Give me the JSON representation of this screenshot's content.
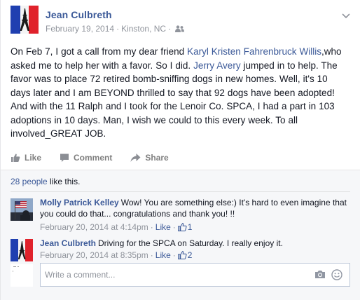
{
  "post": {
    "author": "Jean Culbreth",
    "date": "February 19, 2014",
    "location": "Kinston, NC",
    "audience_icon": "friends-icon",
    "text": {
      "part1": "On Feb 7, I got a call from my dear friend ",
      "link1": "Karyl Kristen Fahrenbruck Willis",
      "part2": ",who asked me to help her with a favor. So I did. ",
      "link2": "Jerry Avery",
      "part3": " jumped in to help. The favor was to place 72 retired bomb-sniffing dogs in new homes. Well, it's 10 days later and I am BEYOND thrilled to say that 92 dogs have been adopted! And with the 11 Ralph and I took for the Lenoir Co. SPCA, I had a part in 103 adoptions in 10 days. Man, I wish we could to this every week. To all involved_GREAT JOB."
    }
  },
  "actions": {
    "like": "Like",
    "comment": "Comment",
    "share": "Share"
  },
  "likes": {
    "link": "28 people",
    "suffix": " like this."
  },
  "comments": [
    {
      "author": "Molly Patrick Kelley",
      "text": "Wow! You are something else:) It's hard to even imagine that you could do that... congratulations and thank you! !!",
      "timestamp": "February 20, 2014 at 4:14pm",
      "like_label": "Like",
      "like_count": "1"
    },
    {
      "author": "Jean Culbreth",
      "text": "Driving for the SPCA on Saturday. I really enjoy it.",
      "timestamp": "February 20, 2014 at 8:35pm",
      "like_label": "Like",
      "like_count": "2"
    }
  ],
  "composer": {
    "placeholder": "Write a comment...",
    "camera_icon": "camera-icon",
    "emoji_icon": "smiley-icon"
  },
  "colors": {
    "link": "#3b5998",
    "meta": "#90949c",
    "text": "#141823",
    "ufi_bg": "#f6f7f9"
  }
}
